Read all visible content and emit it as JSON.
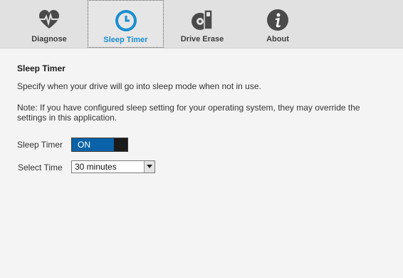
{
  "tabs": [
    {
      "label": "Diagnose",
      "icon": "heart-pulse-icon"
    },
    {
      "label": "Sleep Timer",
      "icon": "clock-icon"
    },
    {
      "label": "Drive Erase",
      "icon": "drive-erase-icon"
    },
    {
      "label": "About",
      "icon": "info-icon"
    }
  ],
  "active_tab": "Sleep Timer",
  "colors": {
    "accent": "#1a8fd0",
    "toggle_on": "#0a63a8",
    "icon_dark": "#4a4a4a"
  },
  "sleep_timer": {
    "title": "Sleep Timer",
    "description": "Specify when your drive will go into sleep mode when not in use.",
    "note": "Note: If you have configured sleep setting for your operating system, they may override the settings in this application.",
    "timer_label": "Sleep Timer",
    "toggle_state": "ON",
    "select_label": "Select Time",
    "select_value": "30 minutes"
  }
}
